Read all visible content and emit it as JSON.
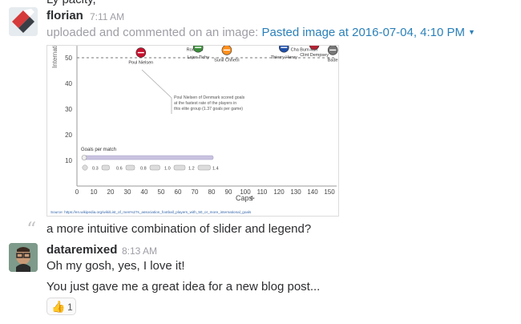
{
  "top_fragment": "Ly pacity,",
  "message1": {
    "author": "florian",
    "time": "7:11 AM",
    "action_text": "uploaded and commented on an image:",
    "image_link": "Pasted image at 2016-07-04, 4:10 PM",
    "comment": "a more intuitive combination of slider and legend?"
  },
  "chart_data": {
    "type": "scatter",
    "title": "",
    "xlabel": "Caps",
    "ylabel": "Internatio",
    "xlim": [
      0,
      150
    ],
    "ylim": [
      0,
      60
    ],
    "x_ticks": [
      "0",
      "10",
      "20",
      "30",
      "40",
      "50",
      "60",
      "70",
      "80",
      "90",
      "100",
      "110",
      "120",
      "130",
      "140",
      "150"
    ],
    "y_ticks": [
      "10",
      "20",
      "30",
      "40",
      "50"
    ],
    "reference_line_y": 50,
    "points": [
      {
        "name": "Poul Nielsen",
        "x": 38,
        "y": 52,
        "color": "#c8102e"
      },
      {
        "name": "Romário",
        "x": 70,
        "y": 57,
        "color": "#2e8b3e"
      },
      {
        "name": "Lajos Tichy",
        "x": 72,
        "y": 54,
        "color": "#3c8d3c"
      },
      {
        "name": "Sunil Chhetri",
        "x": 89,
        "y": 53,
        "color": "#ff8f1c"
      },
      {
        "name": "Thierry Henry",
        "x": 123,
        "y": 54,
        "color": "#1f4fa8"
      },
      {
        "name": "Cha Bum-kun",
        "x": 135,
        "y": 57,
        "color": "#3a5ca8"
      },
      {
        "name": "Clint Dempsey",
        "x": 141,
        "y": 55,
        "color": "#b22234"
      },
      {
        "name": "Bade",
        "x": 152,
        "y": 53,
        "color": "#777777"
      }
    ],
    "annotation": "Poul Nielsen of Denmark scored goals at the fastest rate of the players in this elite group (1.37 goals per game)",
    "legend_title": "Goals per match",
    "legend_values": [
      "0.3",
      "0.6",
      "0.8",
      "1.0",
      "1.2",
      "1.4"
    ],
    "source": "Source: https://en.wikipedia.org/wiki/List_of_men%27s_association_football_players_with_50_or_more_international_goals"
  },
  "message2": {
    "author": "dataremixed",
    "time": "8:13 AM",
    "line1": "Oh my gosh, yes, I love it!",
    "line2": "You just gave me a great idea for a new blog post..."
  },
  "reaction": {
    "emoji": "👍",
    "count": "1"
  }
}
